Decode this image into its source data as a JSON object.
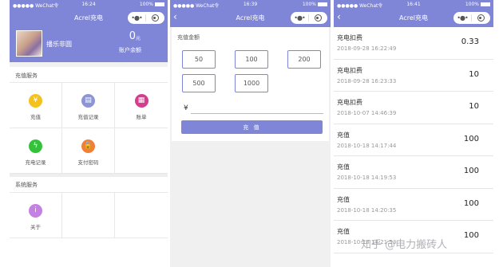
{
  "colors": {
    "accent": "#7f86d8",
    "separator": "#f1f1f1"
  },
  "screens": [
    {
      "status": {
        "carrier": "●●●●● WeChat令",
        "time": "16:24",
        "battery": "100%"
      },
      "nav": {
        "title": "Acrel充电"
      },
      "profile": {
        "username": "播乐非圆",
        "balance": "0",
        "unit": "元",
        "balance_label": "账户余额"
      },
      "charging_section": {
        "title": "充值服务",
        "items": [
          {
            "label": "充值",
            "icon": "money-bag-icon",
            "color": "#f4c21b",
            "glyph": "¥"
          },
          {
            "label": "充值记录",
            "icon": "record-icon",
            "color": "#8c96d6",
            "glyph": "▤"
          },
          {
            "label": "账单",
            "icon": "bill-icon",
            "color": "#d23f8e",
            "glyph": "▦"
          },
          {
            "label": "充电记录",
            "icon": "lightning-icon",
            "color": "#34c23b",
            "glyph": "ϟ"
          },
          {
            "label": "支付密码",
            "icon": "lock-icon",
            "color": "#f08038",
            "glyph": "🔒"
          }
        ]
      },
      "system_section": {
        "title": "系统服务",
        "items": [
          {
            "label": "关于",
            "icon": "info-icon",
            "color": "#c480e2",
            "glyph": "i"
          }
        ]
      }
    },
    {
      "status": {
        "carrier": "●●●●● WeChat令",
        "time": "16:39",
        "battery": "100%"
      },
      "nav": {
        "title": "Acrel充电"
      },
      "recharge": {
        "heading": "充值金额",
        "amounts": [
          "50",
          "100",
          "200",
          "500",
          "1000"
        ],
        "currency": "¥",
        "input_value": "",
        "button": "充 值"
      }
    },
    {
      "status": {
        "carrier": "●●●●● WeChat令",
        "time": "16:41",
        "battery": "100%"
      },
      "nav": {
        "title": "Acrel充电"
      },
      "records": [
        {
          "title": "充电扣费",
          "date": "2018-09-28 16:22:49",
          "value": "0.33"
        },
        {
          "title": "充电扣费",
          "date": "2018-09-28 16:23:33",
          "value": "10"
        },
        {
          "title": "充电扣费",
          "date": "2018-10-07 14:46:39",
          "value": "10"
        },
        {
          "title": "充值",
          "date": "2018-10-18 14:17:44",
          "value": "100"
        },
        {
          "title": "充值",
          "date": "2018-10-18 14:19:53",
          "value": "100"
        },
        {
          "title": "充值",
          "date": "2018-10-18 14:20:35",
          "value": "100"
        },
        {
          "title": "充值",
          "date": "2018-10-18 14:21:53",
          "value": "100"
        }
      ]
    }
  ],
  "watermark": "知乎 @电力搬砖人"
}
